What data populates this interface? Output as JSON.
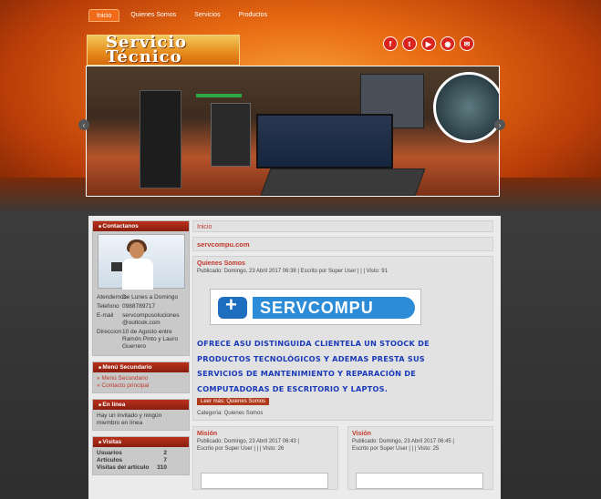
{
  "nav": {
    "items": [
      {
        "label": "Inicio",
        "active": true
      },
      {
        "label": "Quienes Somos",
        "active": false
      },
      {
        "label": "Servicios",
        "active": false
      },
      {
        "label": "Productos",
        "active": false
      }
    ]
  },
  "logo": {
    "line1": "Servicio",
    "line2": "Técnico"
  },
  "social": [
    {
      "icon": "facebook-icon",
      "glyph": "f"
    },
    {
      "icon": "twitter-icon",
      "glyph": "t"
    },
    {
      "icon": "youtube-icon",
      "glyph": "▶"
    },
    {
      "icon": "rss-icon",
      "glyph": "◉"
    },
    {
      "icon": "mail-icon",
      "glyph": "✉"
    }
  ],
  "slider": {
    "prev": "‹",
    "next": "›"
  },
  "sidebar": {
    "contact": {
      "title": "Contactanos",
      "rows": [
        {
          "k": "Atendemos",
          "v": "De Lunes a Domingo"
        },
        {
          "k": "Telefono",
          "v": "0988789717"
        },
        {
          "k": "E-mail",
          "v": "servcompusoluciones @outlook.com"
        },
        {
          "k": "Direccion",
          "v": "10 de Agosto entre Ramón Pinto y Lauro Guerrero"
        }
      ]
    },
    "secondary_menu": {
      "title": "Menú Secundario",
      "items": [
        "» Menú Secundario",
        "» Contacto principal"
      ]
    },
    "online": {
      "title": "En línea",
      "text": "Hay un invitado y ningún miembro en línea"
    },
    "visits": {
      "title": "Visitas",
      "rows": [
        {
          "k": "Usuarios",
          "v": "2"
        },
        {
          "k": "Artículos",
          "v": "7"
        },
        {
          "k": "Visitas del artículo",
          "v": "310"
        }
      ]
    }
  },
  "content": {
    "breadcrumb": "Inicio",
    "site_title": "servcompu.com",
    "article": {
      "title": "Quienes Somos",
      "meta": "Publicado: Domingo, 23 Abril 2017 06:38 | Escrito por Super User | | | Visto: 91",
      "banner_text": "SERVCOMPU",
      "body": [
        "OFRECE ASU DISTINGUIDA CLIENTELA UN STOOCK DE",
        "PRODUCTOS TECNOLÓGICOS Y ADEMAS PRESTA SUS",
        "SERVICIOS DE MANTENIMIENTO Y REPARACIÓN DE",
        "COMPUTADORAS DE ESCRITORIO Y LAPTOS."
      ],
      "read_more": "Leer más: Quienes Somos",
      "category": "Categoría: Quienes Somos"
    },
    "columns": [
      {
        "title": "Misión",
        "meta1": "Publicado: Domingo, 23 Abril 2017 06:43 |",
        "meta2": "Escrito por Super User | | | Visto: 26"
      },
      {
        "title": "Visión",
        "meta1": "Publicado: Domingo, 23 Abril 2017 06:45 |",
        "meta2": "Escrito por Super User | | | Visto: 25"
      }
    ]
  }
}
